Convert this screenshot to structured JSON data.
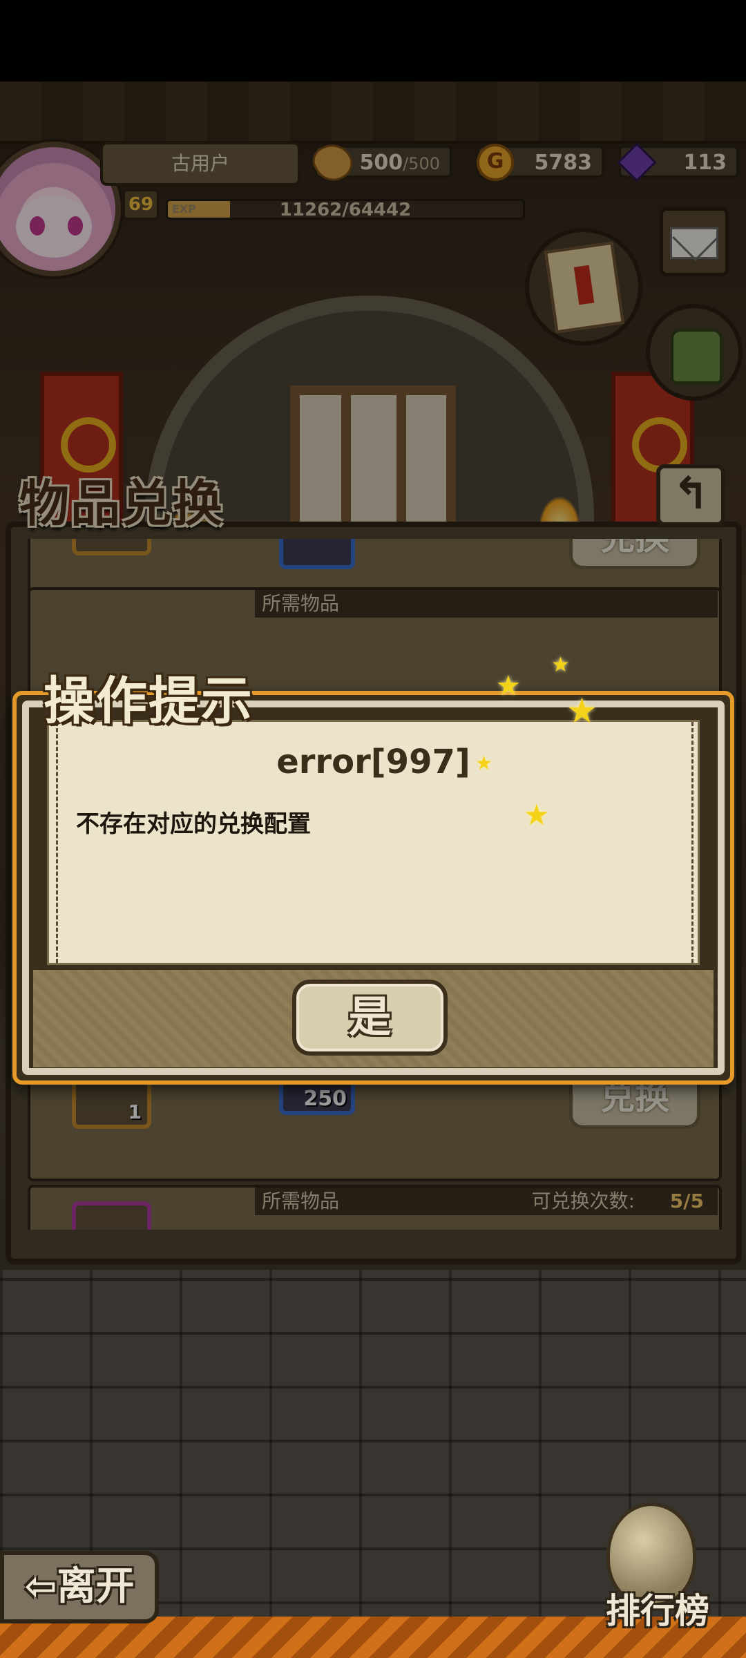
{
  "hud": {
    "player_name": "古用户",
    "level": "69",
    "exp_label": "EXP",
    "exp_text": "11262/64442",
    "exp_fraction": 0.175,
    "bread_value": "500",
    "bread_max": "/500",
    "gold_symbol": "G",
    "gold_value": "5783",
    "gem_value": "113"
  },
  "panel": {
    "title": "物品兑换",
    "back_symbol": "↰",
    "rows": [
      {
        "need_header": "所需物品",
        "item_qty": "",
        "need_qty": "",
        "exchange_label": "兑换"
      },
      {
        "need_header": "所需物品",
        "item_qty": "1",
        "need_qty": "250",
        "exchange_label": "兑换"
      },
      {
        "need_header": "所需物品",
        "count_label": "可兑换次数:",
        "count_value": "5/5"
      }
    ]
  },
  "dialog": {
    "title": "操作提示",
    "heading": "error[997]",
    "message": "不存在对应的兑换配置",
    "confirm_label": "是"
  },
  "nav": {
    "leave_label": "⇦离开",
    "rank_label": "排行榜"
  },
  "colors": {
    "dialog_border": "#e59a2a",
    "dialog_paper": "#ece3cb",
    "star": "#f5d21a"
  }
}
